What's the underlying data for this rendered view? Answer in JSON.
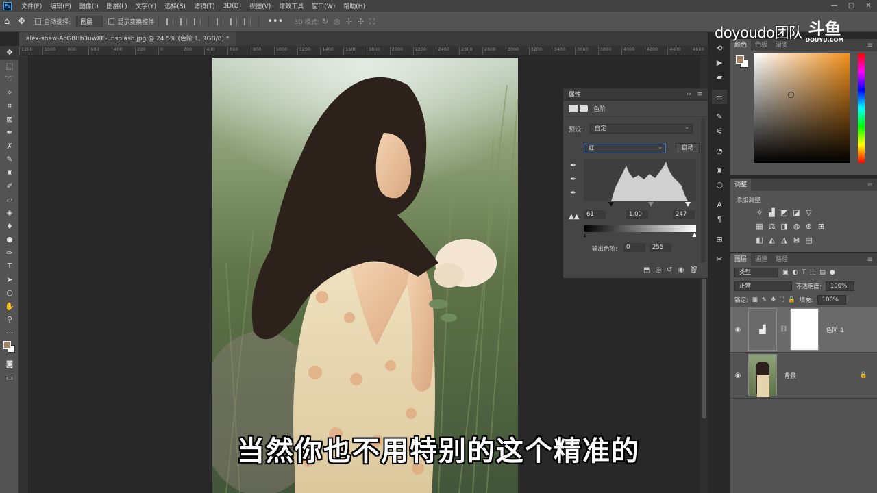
{
  "app": {
    "logo": "Ps"
  },
  "menu": [
    "文件(F)",
    "编辑(E)",
    "图像(I)",
    "图层(L)",
    "文字(Y)",
    "选择(S)",
    "滤镜(T)",
    "3D(D)",
    "视图(V)",
    "增效工具",
    "窗口(W)",
    "帮助(H)"
  ],
  "window_controls": [
    "—",
    "▢",
    "✕"
  ],
  "options": {
    "auto_select_label": "自动选择:",
    "auto_select_value": "图层",
    "show_transform_label": "显示变换控件",
    "mode_3d_label": "3D 模式:"
  },
  "document": {
    "tab_title": "alex-shaw-AcG8Hh3uwXE-unsplash.jpg @ 24.5% (色阶 1, RGB/8) *"
  },
  "ruler_marks": [
    "1200",
    "1000",
    "800",
    "600",
    "400",
    "200",
    "0",
    "200",
    "400",
    "600",
    "800",
    "1000",
    "1200",
    "1400",
    "1600",
    "1800",
    "2000",
    "2200",
    "2400",
    "2600",
    "2800",
    "3000",
    "3200",
    "3400",
    "3600",
    "3800",
    "4000",
    "4200",
    "4400",
    "4600",
    "4800",
    "5000",
    "5200",
    "5400",
    "5600"
  ],
  "properties": {
    "panel_title": "属性",
    "adjustment_name": "色阶",
    "preset_label": "预设:",
    "preset_value": "自定",
    "channel": "红",
    "auto_button": "自动",
    "input_black": "61",
    "input_gamma": "1.00",
    "input_white": "247",
    "output_label": "输出色阶:",
    "output_black": "0",
    "output_white": "255"
  },
  "color_panel": {
    "tabs": [
      "颜色",
      "色板",
      "渐变"
    ],
    "foreground": "#a08467",
    "background": "#ffffff"
  },
  "adjustments_panel": {
    "tab": "调整",
    "add_label": "添加调整"
  },
  "layers_panel": {
    "tabs": [
      "图层",
      "通道",
      "路径"
    ],
    "filter_value": "类型",
    "blend_mode": "正常",
    "opacity_label": "不透明度:",
    "opacity_value": "100%",
    "lock_label": "锁定:",
    "fill_label": "填充:",
    "fill_value": "100%",
    "layers": [
      {
        "name": "色阶 1",
        "selected": true
      },
      {
        "name": "背景",
        "selected": false
      }
    ]
  },
  "subtitle": "当然你也不用特别的这个精准的",
  "watermark": {
    "text": "doyoudo团队",
    "logo_big": "斗鱼",
    "logo_small": "DOUYU.COM"
  }
}
